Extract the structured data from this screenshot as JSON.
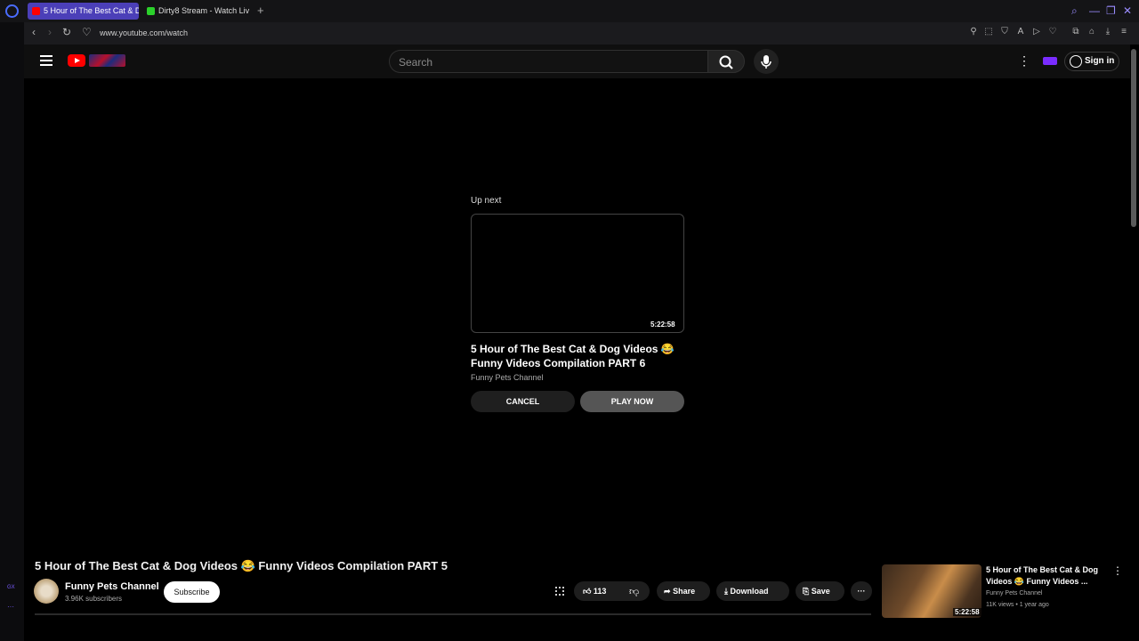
{
  "browser": {
    "tabs": [
      {
        "label": "5 Hour of The Best Cat & D",
        "active": true
      },
      {
        "label": "Dirty8 Stream - Watch Liv",
        "active": false
      }
    ],
    "url": "www.youtube.com/watch"
  },
  "header": {
    "search_placeholder": "Search",
    "sign_in": "Sign in"
  },
  "up_next": {
    "label": "Up next",
    "duration": "5:22:58",
    "title": "5 Hour of The Best Cat & Dog Videos 😂 Funny Videos Compilation PART 6",
    "channel": "Funny Pets Channel",
    "cancel": "CANCEL",
    "play_now": "PLAY NOW"
  },
  "video": {
    "title": "5 Hour of The Best Cat & Dog Videos 😂 Funny Videos Compilation PART 5",
    "channel": "Funny Pets Channel",
    "subscribers": "3.96K subscribers",
    "subscribe": "Subscribe",
    "likes": "113",
    "share": "Share",
    "download": "Download",
    "save": "Save"
  },
  "sidebar_video": {
    "title": "5 Hour of The Best Cat & Dog Videos 😂 Funny Videos ...",
    "channel": "Funny Pets Channel",
    "meta": "11K views • 1 year ago",
    "duration": "5:22:58"
  },
  "colors": {
    "accent": "#ff0000",
    "tab_active": "#4b3fb8"
  }
}
